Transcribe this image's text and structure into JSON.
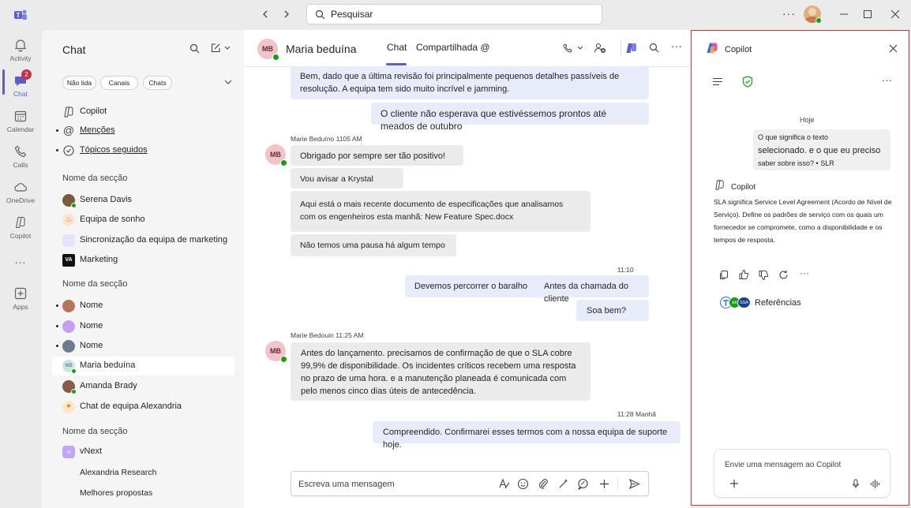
{
  "titlebar": {
    "search_placeholder": "Pesquisar"
  },
  "rail": {
    "items": [
      {
        "label": "Activity"
      },
      {
        "label": "Chat",
        "badge": "2"
      },
      {
        "label": "Calendar"
      },
      {
        "label": "Calls"
      },
      {
        "label": "OneDrive"
      },
      {
        "label": "Copilot"
      },
      {
        "label": "..."
      },
      {
        "label": "Apps"
      }
    ]
  },
  "chatlist": {
    "title": "Chat",
    "filters": [
      "Não lida",
      "Canais",
      "Chats"
    ],
    "pinned": [
      {
        "label": "Copilot"
      },
      {
        "label": "Menções"
      },
      {
        "label": "Tópicos seguidos"
      }
    ],
    "sections": [
      {
        "title": "Nome da secção",
        "items": [
          "Serena Davis",
          "Equipa de sonho",
          "Sincronização da equipa de marketing",
          "Marketing"
        ]
      },
      {
        "title": "Nome da secção",
        "items": [
          "Nome",
          "Nome",
          "Nome",
          "Maria beduína",
          "Amanda Brady",
          "Chat de equipa Alexandria"
        ]
      },
      {
        "title": "Nome da secção",
        "items": [
          "vNext",
          "Alexandria Research",
          "Melhores propostas"
        ]
      }
    ]
  },
  "chat": {
    "contact_name": "Maria beduína",
    "contact_initials": "MB",
    "tabs": [
      "Chat",
      "Compartilhada @"
    ],
    "messages": {
      "m1": "Bem, dado que a última revisão foi principalmente pequenos detalhes passíveis de resolução. A equipa tem sido muito incrível e jamming.",
      "m2": "O cliente não esperava que estivéssemos prontos até meados de outubro",
      "meta1": "Marie Beduíno 1105 AM",
      "m3": "Obrigado por sempre ser tão positivo!",
      "m4": "Vou avisar a Krystal",
      "m5": "Aqui está o mais recente documento de especificações que analisamos com os engenheiros esta manhã: New Feature Spec.docx",
      "m6": "Não temos uma pausa há algum tempo",
      "time1": "11:10",
      "m7a": "Devemos percorrer o baralho",
      "m7b": "Antes da chamada do cliente",
      "m8": "Soa bem?",
      "meta2": "Marie Bedouin 11:25 AM",
      "m9": "Antes do lançamento. precisamos de confirmação de que o SLA cobre 99,9% de disponibilidade. Os incidentes críticos recebem uma resposta no prazo de uma hora. e a manutenção planeada é comunicada com pelo menos cinco dias úteis de antecedência.",
      "time2": "11:28",
      "time2_suffix": "Manhã",
      "m10": "Compreendido. Confirmarei esses termos com a nossa equipa de suporte hoje."
    },
    "compose_placeholder": "Escreva uma mensagem"
  },
  "copilot": {
    "title": "Copilot",
    "day": "Hoje",
    "user_msg_1": "O que significa o texto",
    "user_msg_2": "selecionado. e o que eu preciso",
    "user_msg_3": "saber sobre isso? • SLR",
    "reply_name": "Copilot",
    "reply": "SLA significa Service Level Agreement (Acordo de Nível de Serviço). Define os padrões de serviço com os quais um fornecedor se compromete, como a disponibilidade e os tempos de resposta.",
    "references_label": "Referências",
    "ref_badges": [
      "",
      "ex",
      "SSA"
    ],
    "input_placeholder": "Envie uma mensagem ao Copilot"
  }
}
